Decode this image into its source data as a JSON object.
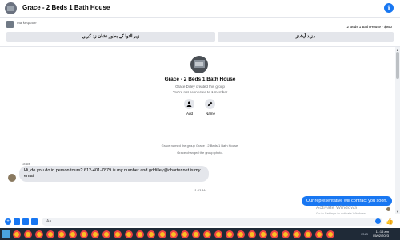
{
  "header": {
    "title": "Grace - 2 Beds 1 Bath House"
  },
  "marketplace": {
    "label": "Marketplace",
    "listing": "2 Beds 1 Bath House · $950"
  },
  "actions": {
    "mark_label": "زیر التوا کے بطور نشان زد کریں",
    "more_label": "مزید آپشنز"
  },
  "group": {
    "name": "Grace - 2 Beds 1 Bath House",
    "created": "Grace Dilley created this group",
    "connection": "You're not connected to 1 member",
    "add_label": "Add",
    "name_label": "Name"
  },
  "system_messages": [
    "Grace named the group Grace - 2 Beds 1 Bath House.",
    "Grace changed the group photo."
  ],
  "messages": {
    "incoming_sender": "Grace",
    "incoming_text": "Hi, do you do in person tours? 612-401-7879 is my number and gddilley@charter.net is my email",
    "timestamp": "11:13 AM",
    "outgoing_text": "Our representative will contract you soon."
  },
  "watermark": {
    "title": "Activate Windows",
    "subtitle": "Go to Settings to activate Windows."
  },
  "composer": {
    "placeholder": "Aa"
  },
  "taskbar": {
    "time": "11:15 am",
    "date": "05/02/2023",
    "tray": "ENG"
  },
  "colors": {
    "accent": "#1877f2",
    "bubble_in": "#e4e6eb",
    "taskbar": "#1f2a37"
  }
}
